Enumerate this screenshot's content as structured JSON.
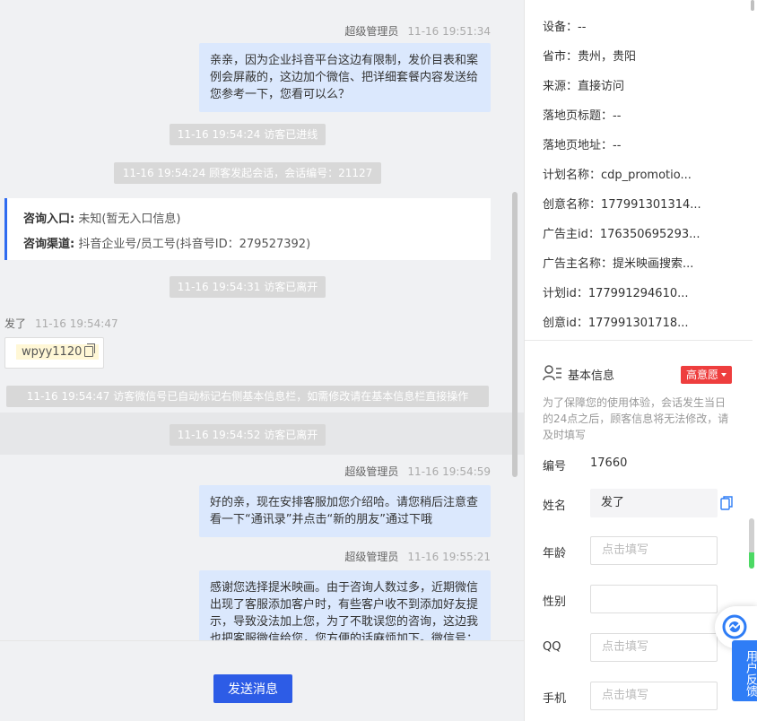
{
  "colors": {
    "accent": "#2d5ce6",
    "bubble": "#dbe8fd",
    "badge": "#ee3e3e",
    "feedback": "#2f7df6"
  },
  "chat": {
    "msg1": {
      "name": "超级管理员",
      "time": "11-16 19:51:34",
      "text": "亲亲，因为企业抖音平台这边有限制，发价目表和案例会屏蔽的，这边加个微信、把详细套餐内容发送给您参考一下，您看可以么？"
    },
    "sys1": "11-16 19:54:24 访客已进线",
    "sys2": "11-16 19:54:24 顾客发起会话，会话编号：21127",
    "entry": {
      "k1": "咨询入口:",
      "v1": "未知(暂无入口信息)",
      "k2": "咨询渠道:",
      "v2": "抖音企业号/员工号(抖音号ID：279527392)"
    },
    "sys3": "11-16 19:54:31 访客已离开",
    "visitor": {
      "name": "发了",
      "time": "11-16 19:54:47",
      "wechat": "wpyy1120"
    },
    "sys4": "11-16 19:54:47 访客微信号已自动标记右侧基本信息栏，如需修改请在基本信息栏直接操作",
    "sys5": "11-16 19:54:52 访客已离开",
    "msg2": {
      "name": "超级管理员",
      "time": "11-16 19:54:59",
      "text": "好的亲，现在安排客服加您介绍哈。请您稍后注意查看一下“通讯录”并点击“新的朋友”通过下哦"
    },
    "msg3": {
      "name": "超级管理员",
      "time": "11-16 19:55:21",
      "text": "感谢您选择提米映画。由于咨询人数过多，近期微信出现了客服添加客户时，有些客户收不到添加好友提示，导致没法加上您，为了不耽误您的咨询，这边我也把客服微信给您，您方便的话麻烦加下。微信号："
    },
    "send_label": "发送消息"
  },
  "side": {
    "info": [
      "设备：--",
      "省市：贵州，贵阳",
      "来源：直接访问",
      "落地页标题：--",
      "落地页地址：--",
      "计划名称：cdp_promotio...",
      "创意名称：177991301314...",
      "广告主id：176350695293...",
      "广告主名称：提米映画搜索...",
      "计划id：177991294610...",
      "创意id：177991301718..."
    ],
    "basic_title": "基本信息",
    "intent_badge": "高意愿",
    "notice": "为了保障您的使用体验，会话发生当日的24点之后，顾客信息将无法修改，请及时填写",
    "id_label": "编号",
    "id_value": "17660",
    "name_label": "姓名",
    "name_value": "发了",
    "age_label": "年龄",
    "age_placeholder": "点击填写",
    "gender_label": "性别",
    "qq_label": "QQ",
    "qq_placeholder": "点击填写",
    "phone_label": "手机",
    "phone_placeholder": "点击填写"
  },
  "feedback_label": "用户反馈"
}
